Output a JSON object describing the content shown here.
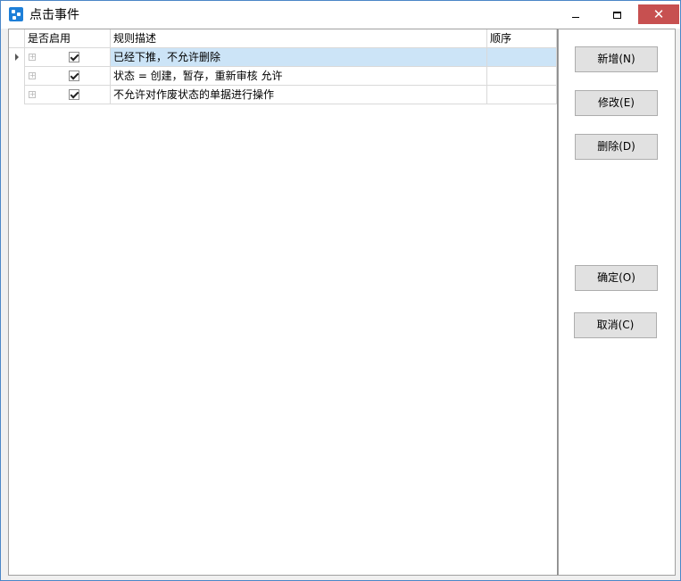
{
  "window": {
    "title": "点击事件",
    "minimize_glyph": "",
    "close_glyph": "✕"
  },
  "grid": {
    "columns": [
      "是否启用",
      "规则描述",
      "顺序"
    ],
    "rows": [
      {
        "enabled": true,
        "description": "已经下推，不允许删除",
        "order": "",
        "selected": true
      },
      {
        "enabled": true,
        "description": "状态 = 创建，暂存，重新审核 允许",
        "order": "",
        "selected": false
      },
      {
        "enabled": true,
        "description": "不允许对作废状态的单据进行操作",
        "order": "",
        "selected": false
      }
    ]
  },
  "buttons": {
    "add": "新增(N)",
    "edit": "修改(E)",
    "delete": "删除(D)",
    "ok": "确定(O)",
    "cancel": "取消(C)"
  },
  "colors": {
    "selected_row": "#cce4f7",
    "close_button": "#c75050",
    "app_icon": "#1e7fd8"
  }
}
